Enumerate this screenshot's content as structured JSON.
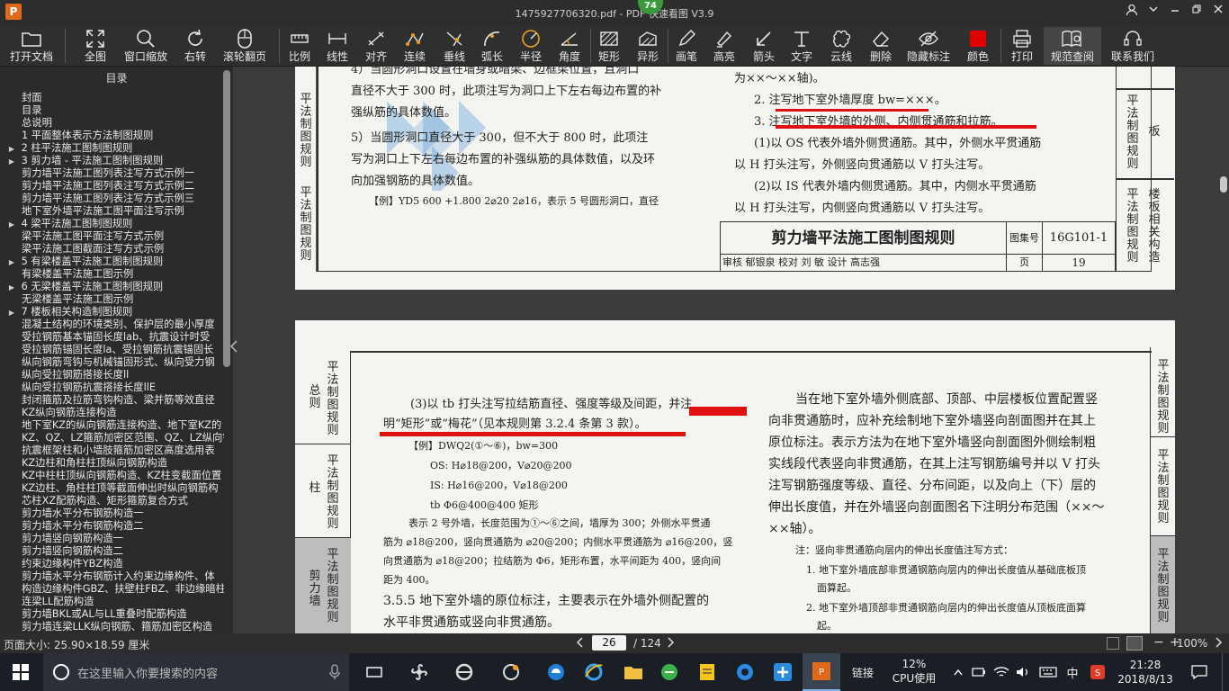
{
  "titlebar": {
    "title": "1475927706320.pdf - PDF 快速看图 V3.9",
    "badge": "74",
    "logo": "P"
  },
  "toolbar": [
    {
      "id": "open",
      "label": "打开文档"
    },
    {
      "id": "fit",
      "label": "全图"
    },
    {
      "id": "zoom",
      "label": "窗口缩放"
    },
    {
      "id": "rotate",
      "label": "右转"
    },
    {
      "id": "scroll",
      "label": "滚轮翻页"
    },
    {
      "id": "scale",
      "label": "比例"
    },
    {
      "id": "linear",
      "label": "线性"
    },
    {
      "id": "align",
      "label": "对齐"
    },
    {
      "id": "continuous",
      "label": "连续"
    },
    {
      "id": "perp",
      "label": "垂线"
    },
    {
      "id": "arc",
      "label": "弧长"
    },
    {
      "id": "radius",
      "label": "半径"
    },
    {
      "id": "angle",
      "label": "角度"
    },
    {
      "id": "rect",
      "label": "矩形"
    },
    {
      "id": "shape",
      "label": "异形"
    },
    {
      "id": "pen",
      "label": "画笔"
    },
    {
      "id": "highlight",
      "label": "高亮"
    },
    {
      "id": "arrow",
      "label": "箭头"
    },
    {
      "id": "text",
      "label": "文字"
    },
    {
      "id": "cloud",
      "label": "云线"
    },
    {
      "id": "delete",
      "label": "删除"
    },
    {
      "id": "hide",
      "label": "隐藏标注"
    },
    {
      "id": "color",
      "label": "颜色"
    },
    {
      "id": "print",
      "label": "打印"
    },
    {
      "id": "spec",
      "label": "规范查阅"
    },
    {
      "id": "contact",
      "label": "联系我们"
    }
  ],
  "sidebar": {
    "title": "目录",
    "items": [
      {
        "label": "封面",
        "arrow": false
      },
      {
        "label": "目录",
        "arrow": false
      },
      {
        "label": "总说明",
        "arrow": false
      },
      {
        "label": "1 平面整体表示方法制图规则",
        "arrow": false
      },
      {
        "label": "2 柱平法施工图制图规则",
        "arrow": true
      },
      {
        "label": "3 剪力墙 - 平法施工图制图规则",
        "arrow": true
      },
      {
        "label": "剪力墙平法施工图列表注写方式示例一",
        "arrow": false
      },
      {
        "label": "剪力墙平法施工图列表注写方式示例二",
        "arrow": false
      },
      {
        "label": "剪力墙平法施工图列表注写方式示例三",
        "arrow": false
      },
      {
        "label": "地下室外墙平法施工图平面注写示例",
        "arrow": false
      },
      {
        "label": "4 梁平法施工图制图规则",
        "arrow": true
      },
      {
        "label": "梁平法施工图平面注写方式示例",
        "arrow": false
      },
      {
        "label": "梁平法施工图截面注写方式示例",
        "arrow": false
      },
      {
        "label": "5 有梁楼盖平法施工图制图规则",
        "arrow": true
      },
      {
        "label": "有梁楼盖平法施工图示例",
        "arrow": false
      },
      {
        "label": "6 无梁楼盖平法施工图制图规则",
        "arrow": true
      },
      {
        "label": "无梁楼盖平法施工图示例",
        "arrow": false
      },
      {
        "label": "7 楼板相关构造制图规则",
        "arrow": true
      },
      {
        "label": "混凝土结构的环境类别、保护层的最小厚度",
        "arrow": false
      },
      {
        "label": "受拉钢筋基本锚固长度lab、抗震设计时受",
        "arrow": false
      },
      {
        "label": "受拉钢筋锚固长度la、受拉钢筋抗震锚固长",
        "arrow": false
      },
      {
        "label": "纵向钢筋弯钩与机械锚固形式、纵向受力钢",
        "arrow": false
      },
      {
        "label": "纵向受拉钢筋搭接长度ll",
        "arrow": false
      },
      {
        "label": "纵向受拉钢筋抗震搭接长度llE",
        "arrow": false
      },
      {
        "label": "封闭箍筋及拉筋弯钩构造、梁并筋等效直径",
        "arrow": false
      },
      {
        "label": "KZ纵向钢筋连接构造",
        "arrow": false
      },
      {
        "label": "地下室KZ的纵向钢筋连接构造、地下室KZ的",
        "arrow": false
      },
      {
        "label": "KZ、QZ、LZ箍筋加密区范围、QZ、LZ纵向钢",
        "arrow": false
      },
      {
        "label": "抗震框架柱和小墙肢箍筋加密区高度选用表",
        "arrow": false
      },
      {
        "label": "KZ边柱和角柱柱顶纵向钢筋构造",
        "arrow": false
      },
      {
        "label": "KZ中柱柱顶纵向钢筋构造、KZ柱变截面位置",
        "arrow": false
      },
      {
        "label": "KZ边柱、角柱柱顶等截面伸出时纵向钢筋构",
        "arrow": false
      },
      {
        "label": "芯柱XZ配筋构造、矩形箍筋复合方式",
        "arrow": false
      },
      {
        "label": "剪力墙水平分布钢筋构造一",
        "arrow": false
      },
      {
        "label": "剪力墙水平分布钢筋构造二",
        "arrow": false
      },
      {
        "label": "剪力墙竖向钢筋构造一",
        "arrow": false
      },
      {
        "label": "剪力墙竖向钢筋构造二",
        "arrow": false
      },
      {
        "label": "约束边缘构件YBZ构造",
        "arrow": false
      },
      {
        "label": "剪力墙水平分布钢筋计入约束边缘构件、体",
        "arrow": false
      },
      {
        "label": "构造边缘构件GBZ、扶壁柱FBZ、非边缘暗柱",
        "arrow": false
      },
      {
        "label": "连梁LL配筋构造",
        "arrow": false
      },
      {
        "label": "剪力墙BKL或AL与LL重叠时配筋构造",
        "arrow": false
      },
      {
        "label": "剪力墙连梁LLK纵向钢筋、箍筋加密区构造",
        "arrow": false
      }
    ]
  },
  "page1": {
    "left_lines": [
      "4）当圆形洞口设置在墙身或暗梁、边框梁位置，且洞口",
      "直径不大于 300 时，此项注写为洞口上下左右每边布置的补",
      "强纵筋的具体数值。",
      "5）当圆形洞口直径大于 300，但不大于 800 时，此项注",
      "写为洞口上下左右每边布置的补强纵筋的具体数值，以及环",
      "向加强钢筋的具体数值。",
      "【例】YD5  600  +1.800  2⌀20  2⌀16，表示 5 号圆形洞口，直径"
    ],
    "right_lines": [
      "为××～××轴)。",
      "2. 注写地下室外墙厚度 bw=×××。",
      "3. 注写地下室外墙的外侧、内侧贯通筋和拉筋。",
      "(1)以 OS 代表外墙外侧贯通筋。其中，外侧水平贯通筋",
      "以 H 打头注写，外侧竖向贯通筋以 V 打头注写。",
      "(2)以 IS 代表外墙内侧贯通筋。其中，内侧水平贯通筋",
      "以 H 打头注写，内侧竖向贯通筋以 V 打头注写。"
    ],
    "left_side": [
      "平法制图规则",
      "平法制图规则"
    ],
    "right_side": [
      "平法制图规则",
      "板",
      "平法制图规则",
      "楼板相关构造"
    ],
    "title_block": {
      "name": "剪力墙平法施工图制图规则",
      "set_label": "图集号",
      "set_value": "16G101-1",
      "row2": "审核 郁银泉 校对 刘 敏 设计 高志强",
      "page_label": "页",
      "page_value": "19"
    }
  },
  "page2": {
    "left_side": [
      {
        "title": "平法制图规则",
        "cat": "总则"
      },
      {
        "title": "平法制图规则",
        "cat": "柱"
      },
      {
        "title": "平法制图规则",
        "cat": "剪力墙"
      }
    ],
    "right_side": [
      "平法制图规则",
      "平法制图规则",
      "平法制图规则"
    ],
    "left_lines": [
      "(3)以 tb 打头注写拉结筋直径、强度等级及间距，并注",
      "明“矩形”或“梅花”（见本规则第 3.2.4 条第 3 款）。",
      "【例】DWQ2(①～⑥)，bw=300",
      "OS: H⌀18@200，V⌀20@200",
      "IS: H⌀16@200，V⌀18@200",
      "tb  Φ6@400@400 矩形",
      "表示 2 号外墙，长度范围为①～⑥之间，墙厚为 300；外侧水平贯通",
      "筋为 ⌀18@200，竖向贯通筋为 ⌀20@200；内侧水平贯通筋为 ⌀16@200，竖",
      "向贯通筋为 ⌀18@200；拉结筋为 Φ6，矩形布置，水平间距为 400，竖向间",
      "距为 400。",
      "3.5.5 地下室外墙的原位标注，主要表示在外墙外侧配置的",
      "水平非贯通筋或竖向非贯通筋。"
    ],
    "right_lines": [
      "当在地下室外墙外侧底部、顶部、中层楼板位置配置竖",
      "向非贯通筋时，应补充绘制地下室外墙竖向剖面图并在其上",
      "原位标注。表示方法为在地下室外墙竖向剖面图外侧绘制粗",
      "实线段代表竖向非贯通筋，在其上注写钢筋编号并以 V 打头",
      "注写钢筋强度等级、直径、分布间距，以及向上（下）层的",
      "伸出长度值，并在外墙竖向剖面图名下注明分布范围（××～",
      "××轴）。",
      "注：竖向非贯通筋向层内的伸出长度值注写方式：",
      "1. 地下室外墙底部非贯通钢筋向层内的伸出长度值从基础底板顶",
      "面算起。",
      "2. 地下室外墙顶部非贯通钢筋向层内的伸出长度值从顶板底面算",
      "起。"
    ]
  },
  "statusbar": {
    "page_size": "页面大小: 25.90×18.59 厘米",
    "current_page": "26",
    "total_pages": "/ 124",
    "zoom": "100%"
  },
  "taskbar": {
    "search_placeholder": "在这里输入你要搜索的内容",
    "cpu_pct": "12%",
    "cpu_label": "CPU使用",
    "link_label": "链接",
    "ime": "中",
    "time": "21:28",
    "date": "2018/8/13"
  },
  "colors": {
    "accent_red": "#e01010",
    "toolbar_bg": "#2f2f2f",
    "active_bg": "#454545"
  }
}
